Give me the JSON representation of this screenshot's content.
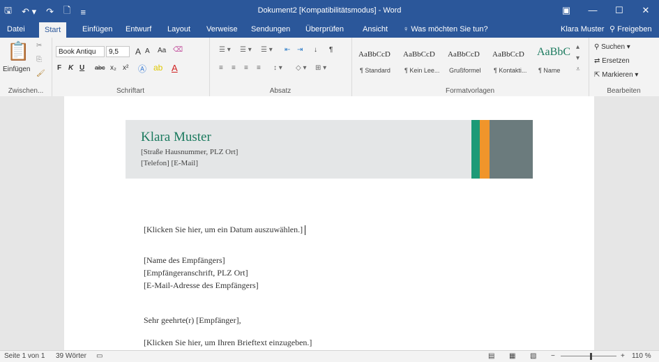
{
  "window": {
    "title": "Dokument2 [Kompatibilitätsmodus] - Word",
    "qat_icons": [
      "save-icon",
      "undo-icon",
      "redo-icon",
      "new-doc-icon",
      "customize-icon"
    ]
  },
  "tabs": [
    {
      "label": "Datei",
      "active": false
    },
    {
      "label": "Start",
      "active": true
    },
    {
      "label": "Einfügen",
      "active": false
    },
    {
      "label": "Entwurf",
      "active": false
    },
    {
      "label": "Layout",
      "active": false
    },
    {
      "label": "Verweise",
      "active": false
    },
    {
      "label": "Sendungen",
      "active": false
    },
    {
      "label": "Überprüfen",
      "active": false
    },
    {
      "label": "Ansicht",
      "active": false
    }
  ],
  "tell_me": "Was möchten Sie tun?",
  "user": "Klara Muster",
  "share": "Freigeben",
  "ribbon": {
    "clipboard": {
      "paste": "Einfügen",
      "label": "Zwischen..."
    },
    "font": {
      "name": "Book Antiqu",
      "size": "9,5",
      "label": "Schriftart",
      "grow": "A",
      "shrink": "A",
      "case": "Aa",
      "bold": "F",
      "italic": "K",
      "underline": "U",
      "strike": "abc",
      "sub": "x₂",
      "sup": "x²"
    },
    "paragraph": {
      "label": "Absatz"
    },
    "styles": {
      "label": "Formatvorlagen",
      "items": [
        {
          "sample": "AaBbCcD",
          "name": "¶ Standard"
        },
        {
          "sample": "AaBbCcD",
          "name": "¶ Kein Lee..."
        },
        {
          "sample": "AaBbCcD",
          "name": "Grußformel"
        },
        {
          "sample": "AaBbCcD",
          "name": "¶ Kontakti..."
        },
        {
          "sample": "AaBbC",
          "name": "¶ Name"
        }
      ]
    },
    "editing": {
      "find": "Suchen",
      "replace": "Ersetzen",
      "select": "Markieren",
      "label": "Bearbeiten"
    }
  },
  "document": {
    "name": "Klara Muster",
    "address": "[Straße Hausnummer, PLZ Ort]",
    "contact": "[Telefon] [E-Mail]",
    "date": "[Klicken Sie hier, um ein Datum auszuwählen.]",
    "recipient_name": "[Name des Empfängers]",
    "recipient_address": "[Empfängeranschrift, PLZ Ort]",
    "recipient_email": "[E-Mail-Adresse des Empfängers]",
    "salutation": "Sehr geehrte(r) [Empfänger],",
    "body": "[Klicken Sie hier, um Ihren Brieftext einzugeben.]"
  },
  "status": {
    "page": "Seite 1 von 1",
    "words": "39 Wörter",
    "zoom": "110 %"
  },
  "colors": {
    "accent": "#2b579a",
    "green": "#1d9a77",
    "orange": "#f0952b",
    "gray": "#6b7b7d"
  }
}
